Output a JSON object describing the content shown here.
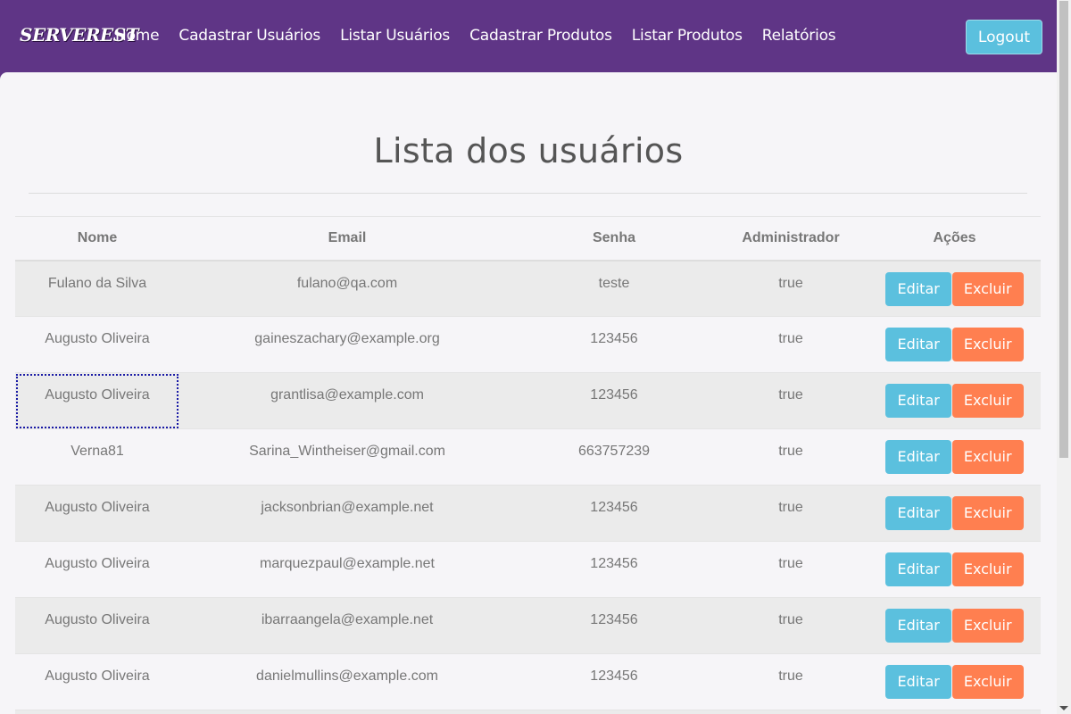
{
  "nav": {
    "brand": "SERVEREST",
    "links": [
      "Home",
      "Cadastrar Usuários",
      "Listar Usuários",
      "Cadastrar Produtos",
      "Listar Produtos",
      "Relatórios"
    ],
    "logout_label": "Logout"
  },
  "page": {
    "title": "Lista dos usuários"
  },
  "table": {
    "headers": [
      "Nome",
      "Email",
      "Senha",
      "Administrador",
      "Ações"
    ],
    "edit_label": "Editar",
    "delete_label": "Excluir",
    "rows": [
      {
        "nome": "Fulano da Silva",
        "email": "fulano@qa.com",
        "senha": "teste",
        "admin": "true"
      },
      {
        "nome": "Augusto Oliveira",
        "email": "gaineszachary@example.org",
        "senha": "123456",
        "admin": "true"
      },
      {
        "nome": "Augusto Oliveira",
        "email": "grantlisa@example.com",
        "senha": "123456",
        "admin": "true"
      },
      {
        "nome": "Verna81",
        "email": "Sarina_Wintheiser@gmail.com",
        "senha": "663757239",
        "admin": "true"
      },
      {
        "nome": "Augusto Oliveira",
        "email": "jacksonbrian@example.net",
        "senha": "123456",
        "admin": "true"
      },
      {
        "nome": "Augusto Oliveira",
        "email": "marquezpaul@example.net",
        "senha": "123456",
        "admin": "true"
      },
      {
        "nome": "Augusto Oliveira",
        "email": "ibarraangela@example.net",
        "senha": "123456",
        "admin": "true"
      },
      {
        "nome": "Augusto Oliveira",
        "email": "danielmullins@example.com",
        "senha": "123456",
        "admin": "true"
      }
    ]
  },
  "colors": {
    "navbar": "#5f3586",
    "edit_button": "#5bc0de",
    "delete_button": "#ff7f50"
  }
}
